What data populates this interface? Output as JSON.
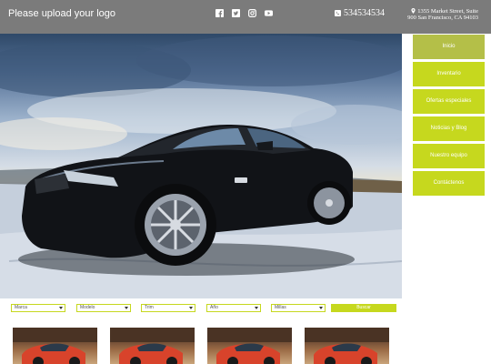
{
  "header": {
    "logo_text": "Please upload your logo",
    "social_icons": [
      "facebook-icon",
      "twitter-icon",
      "instagram-icon",
      "youtube-icon"
    ],
    "phone": "534534534",
    "address_line1": "1355 Market Street, Suite",
    "address_line2": "900 San Francisco, CA 94103"
  },
  "nav": {
    "items": [
      {
        "label": "Inicio"
      },
      {
        "label": "Inventario"
      },
      {
        "label": "Ofertas especiales"
      },
      {
        "label": "Noticias y Blog"
      },
      {
        "label": "Nuestro equipo"
      },
      {
        "label": "Contáctenos"
      }
    ]
  },
  "search": {
    "make": "Marca",
    "model": "Modelo",
    "trim": "Trim",
    "year": "Año",
    "mileage": "Millas",
    "button": "Buscar"
  },
  "colors": {
    "header_bg": "#7b7b7b",
    "accent": "#c6d81e",
    "nav_active": "#b4bf48"
  }
}
